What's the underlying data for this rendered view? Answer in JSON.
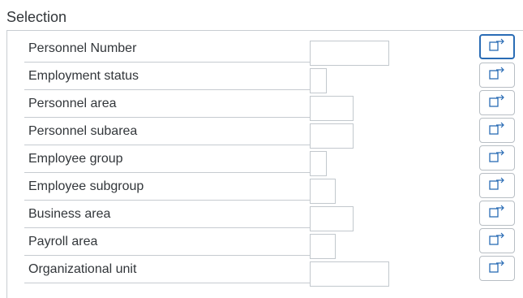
{
  "section": {
    "title": "Selection"
  },
  "rows": [
    {
      "label": "Personnel Number",
      "value": ""
    },
    {
      "label": "Employment status",
      "value": ""
    },
    {
      "label": "Personnel area",
      "value": ""
    },
    {
      "label": "Personnel subarea",
      "value": ""
    },
    {
      "label": "Employee group",
      "value": ""
    },
    {
      "label": "Employee subgroup",
      "value": ""
    },
    {
      "label": "Business area",
      "value": ""
    },
    {
      "label": "Payroll area",
      "value": ""
    },
    {
      "label": "Organizational unit",
      "value": ""
    }
  ],
  "icons": {
    "multiple_selection": "multiple-selection-icon"
  },
  "colors": {
    "focus": "#2a6cb5",
    "icon": "#2a6cb5",
    "text": "#32363a"
  }
}
